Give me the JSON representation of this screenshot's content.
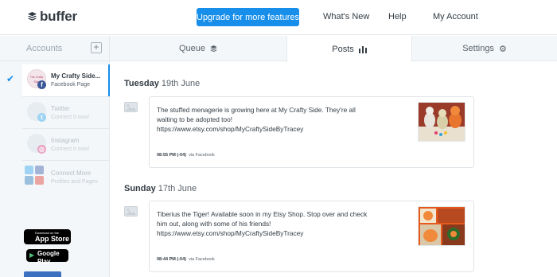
{
  "brand": {
    "name": "buffer"
  },
  "topnav": {
    "upgrade_label": "Upgrade for more features",
    "links": [
      "What's New",
      "Help",
      "My Account"
    ]
  },
  "sidebar": {
    "title": "Accounts",
    "add_symbol": "+",
    "accounts": [
      {
        "name": "My Crafty Side...",
        "sub": "Facebook Page",
        "avatar_text": "The Crafty Side",
        "active": true
      },
      {
        "name": "Twitter",
        "sub": "Connect it now!"
      },
      {
        "name": "Instagram",
        "sub": "Connect it now!"
      },
      {
        "name": "Connect More",
        "sub": "Profiles and Pages"
      }
    ],
    "stores": [
      {
        "small": "Download on the",
        "big": "App Store"
      },
      {
        "small": "GET IT ON",
        "big": "Google Play"
      }
    ]
  },
  "tabs": [
    {
      "label": "Queue",
      "icon": "stack-icon"
    },
    {
      "label": "Posts",
      "icon": "bar-chart-icon",
      "active": true
    },
    {
      "label": "Settings",
      "icon": "gear-icon"
    }
  ],
  "posts": [
    {
      "day": "Tuesday",
      "date": "19th June",
      "text_lines": [
        "The stuffed menagerie is growing here at My Crafty Side. They're all",
        "waiting to be adopted too!",
        "https://www.etsy.com/shop/MyCraftySideByTracey"
      ],
      "time": "08:55 PM (-04)",
      "via": "via Facebook"
    },
    {
      "day": "Sunday",
      "date": "17th June",
      "text_lines": [
        "Tiberius the Tiger! Available soon in my Etsy Shop. Stop over and check",
        "him out, along with some of his friends!",
        "https://www.etsy.com/shop/MyCraftySideByTracey"
      ],
      "time": "08:44 PM (-04)",
      "via": "via Facebook"
    }
  ],
  "colors": {
    "accent": "#168eea",
    "sidebar_bg": "#f4f7f9",
    "text": "#323b43"
  }
}
